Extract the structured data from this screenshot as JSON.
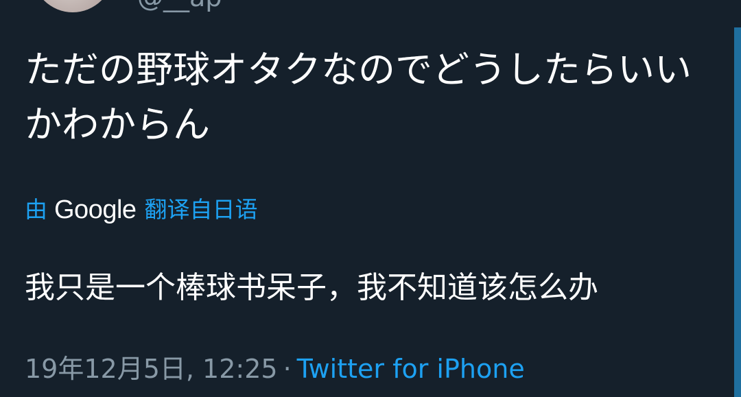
{
  "author": {
    "handle": "@__ap"
  },
  "tweet": {
    "text": "ただの野球オタクなのでどうしたらいいかわからん"
  },
  "translation": {
    "by_label": "由",
    "service": "Google",
    "from_label": "翻译自日语",
    "text": "我只是一个棒球书呆子，我不知道该怎么办"
  },
  "meta": {
    "timestamp": "19年12月5日, 12:25",
    "separator": "·",
    "source": "Twitter for iPhone"
  },
  "colors": {
    "background": "#15202b",
    "text": "#ffffff",
    "link": "#1da1f2",
    "muted": "#8899a6"
  }
}
